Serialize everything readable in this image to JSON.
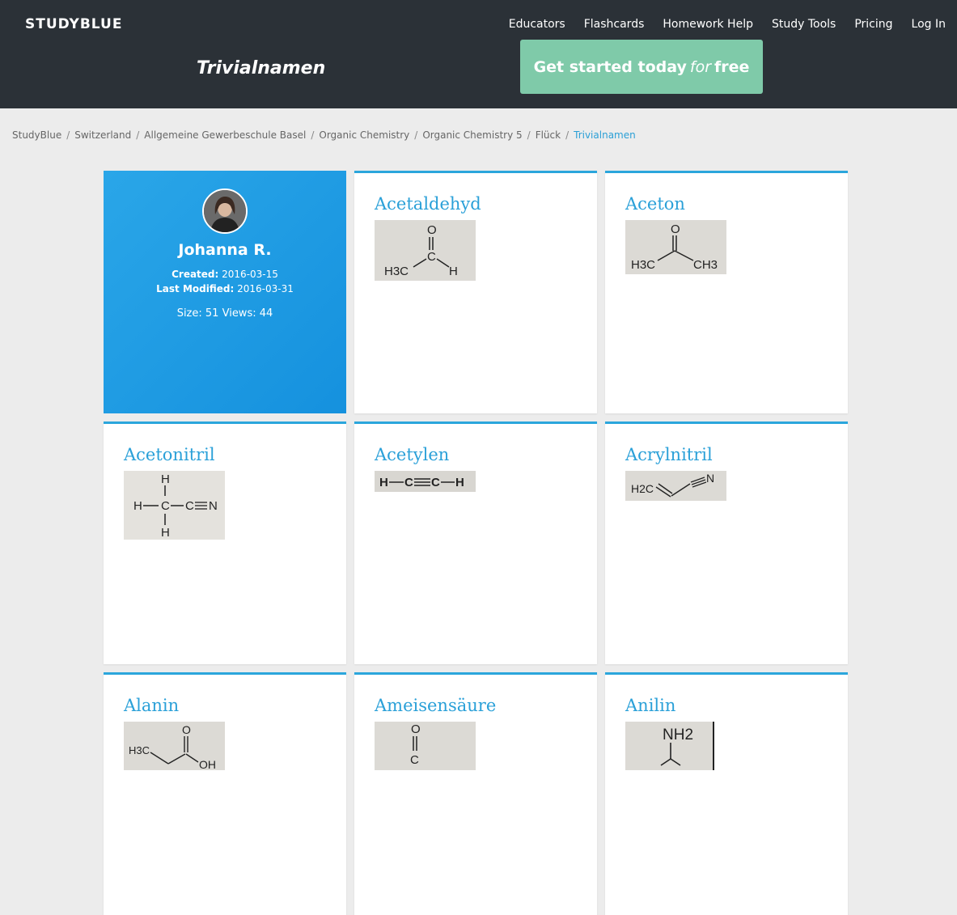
{
  "header": {
    "logo": "STUDYBLUE",
    "nav": [
      "Educators",
      "Flashcards",
      "Homework Help",
      "Study Tools",
      "Pricing",
      "Log In"
    ],
    "deck_title": "Trivialnamen",
    "cta_prefix": "Get started today",
    "cta_for": "for",
    "cta_suffix": "free"
  },
  "breadcrumb": [
    "StudyBlue",
    "Switzerland",
    "Allgemeine Gewerbeschule Basel",
    "Organic Chemistry",
    "Organic Chemistry 5",
    "Flück",
    "Trivialnamen"
  ],
  "profile": {
    "name": "Johanna R.",
    "created_label": "Created:",
    "created": "2016-03-15",
    "modified_label": "Last Modified:",
    "modified": "2016-03-31",
    "size_label": "Size:",
    "size": "51",
    "views_label": "Views:",
    "views": "44"
  },
  "cards": [
    {
      "term": "Acetaldehyd",
      "structure": "acetaldehyde-structure"
    },
    {
      "term": "Aceton",
      "structure": "acetone-structure"
    },
    {
      "term": "Acetonitril",
      "structure": "acetonitrile-structure"
    },
    {
      "term": "Acetylen",
      "structure": "acetylene-structure"
    },
    {
      "term": "Acrylnitril",
      "structure": "acrylonitrile-structure"
    },
    {
      "term": "Alanin",
      "structure": "alanine-structure"
    },
    {
      "term": "Ameisensäure",
      "structure": "formic-acid-structure"
    },
    {
      "term": "Anilin",
      "structure": "aniline-structure"
    }
  ],
  "structure_labels": {
    "acetaldehyde": {
      "o": "O",
      "c": "C",
      "h3c": "H3C",
      "h": "H"
    },
    "acetone": {
      "o": "O",
      "h3c": "H3C",
      "ch3": "CH3"
    },
    "acetonitrile": {
      "h": "H",
      "c": "C",
      "n": "N"
    },
    "acetylene": {
      "h": "H",
      "c": "C"
    },
    "acrylonitrile": {
      "h2c": "H2C",
      "n": "N"
    },
    "alanine": {
      "h3c": "H3C",
      "o": "O",
      "oh": "OH"
    },
    "formic_acid": {
      "o": "O",
      "c": "C"
    },
    "aniline": {
      "nh2": "NH2"
    }
  },
  "colors": {
    "header_bg": "#2b3137",
    "cta": "#7fcaa9",
    "accent": "#2aa0d8",
    "page_bg": "#ececec"
  }
}
